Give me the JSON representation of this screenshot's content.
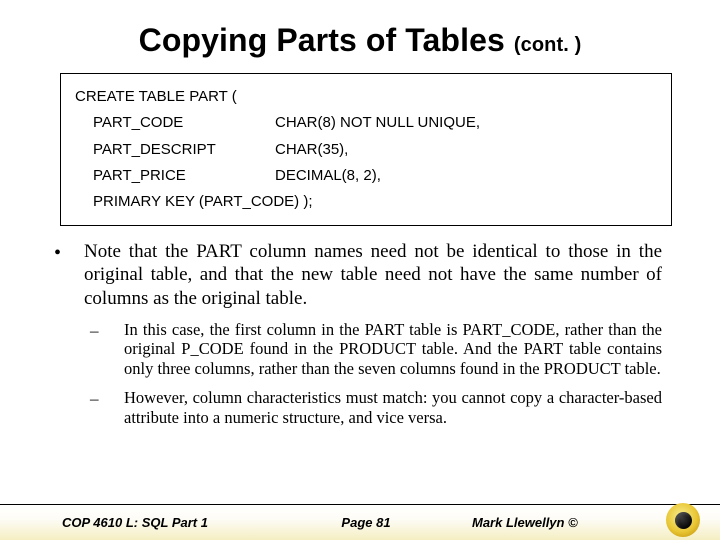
{
  "title": {
    "main": "Copying Parts of Tables",
    "cont": "(cont. )"
  },
  "sql": {
    "header": "CREATE TABLE PART (",
    "rows": [
      {
        "name": "PART_CODE",
        "def": "CHAR(8) NOT NULL   UNIQUE,"
      },
      {
        "name": "PART_DESCRIPT",
        "def": "CHAR(35),"
      },
      {
        "name": "PART_PRICE",
        "def": "DECIMAL(8, 2),"
      }
    ],
    "footer": "PRIMARY KEY (PART_CODE) );"
  },
  "bullets": {
    "main": "Note that the PART column names need not be identical to those in the original table, and that the new table need not have the same number of columns as the original table.",
    "subs": [
      "In this case, the first column in the PART table is PART_CODE, rather than the original P_CODE found in the PRODUCT table.  And the PART table contains only three columns, rather than the seven columns found in the PRODUCT table.",
      "However, column characteristics must match:  you cannot copy a character-based attribute into a numeric structure, and vice versa."
    ]
  },
  "footer": {
    "course": "COP 4610 L: SQL Part 1",
    "page": "Page 81",
    "author": "Mark Llewellyn ©"
  }
}
